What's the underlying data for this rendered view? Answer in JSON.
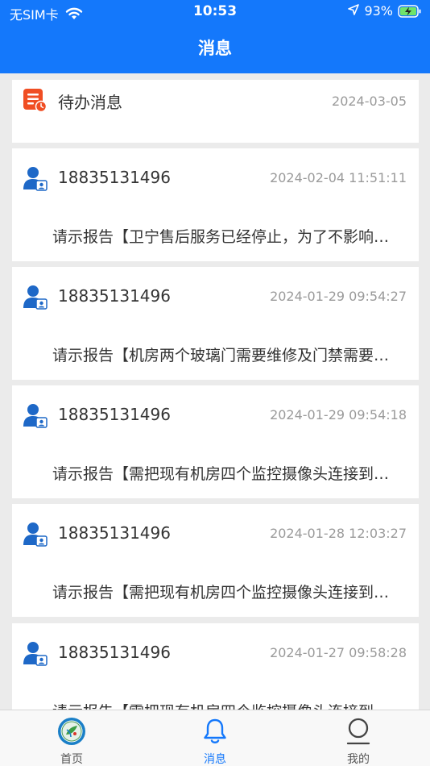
{
  "status_bar": {
    "carrier": "无SIM卡",
    "time": "10:53",
    "battery": "93%"
  },
  "header": {
    "title": "消息"
  },
  "todo": {
    "label": "待办消息",
    "date": "2024-03-05"
  },
  "messages": [
    {
      "sender": "18835131496",
      "time": "2024-02-04 11:51:11",
      "preview": "请示报告【卫宁售后服务已经停止，为了不影响医院正常运营】"
    },
    {
      "sender": "18835131496",
      "time": "2024-01-29 09:54:27",
      "preview": "请示报告【机房两个玻璃门需要维修及门禁需要更换】"
    },
    {
      "sender": "18835131496",
      "time": "2024-01-29 09:54:18",
      "preview": "请示报告【需把现有机房四个监控摄像头连接到监控室】"
    },
    {
      "sender": "18835131496",
      "time": "2024-01-28 12:03:27",
      "preview": "请示报告【需把现有机房四个监控摄像头连接到监控室】"
    },
    {
      "sender": "18835131496",
      "time": "2024-01-27 09:58:28",
      "preview": "请示报告【需把现有机房四个监控摄像头连接到监控室】"
    }
  ],
  "tabbar": {
    "tabs": [
      {
        "label": "首页"
      },
      {
        "label": "消息"
      },
      {
        "label": "我的"
      }
    ]
  },
  "colors": {
    "primary": "#1478fb",
    "todo_icon": "#f04e23",
    "background": "#ebebeb"
  }
}
